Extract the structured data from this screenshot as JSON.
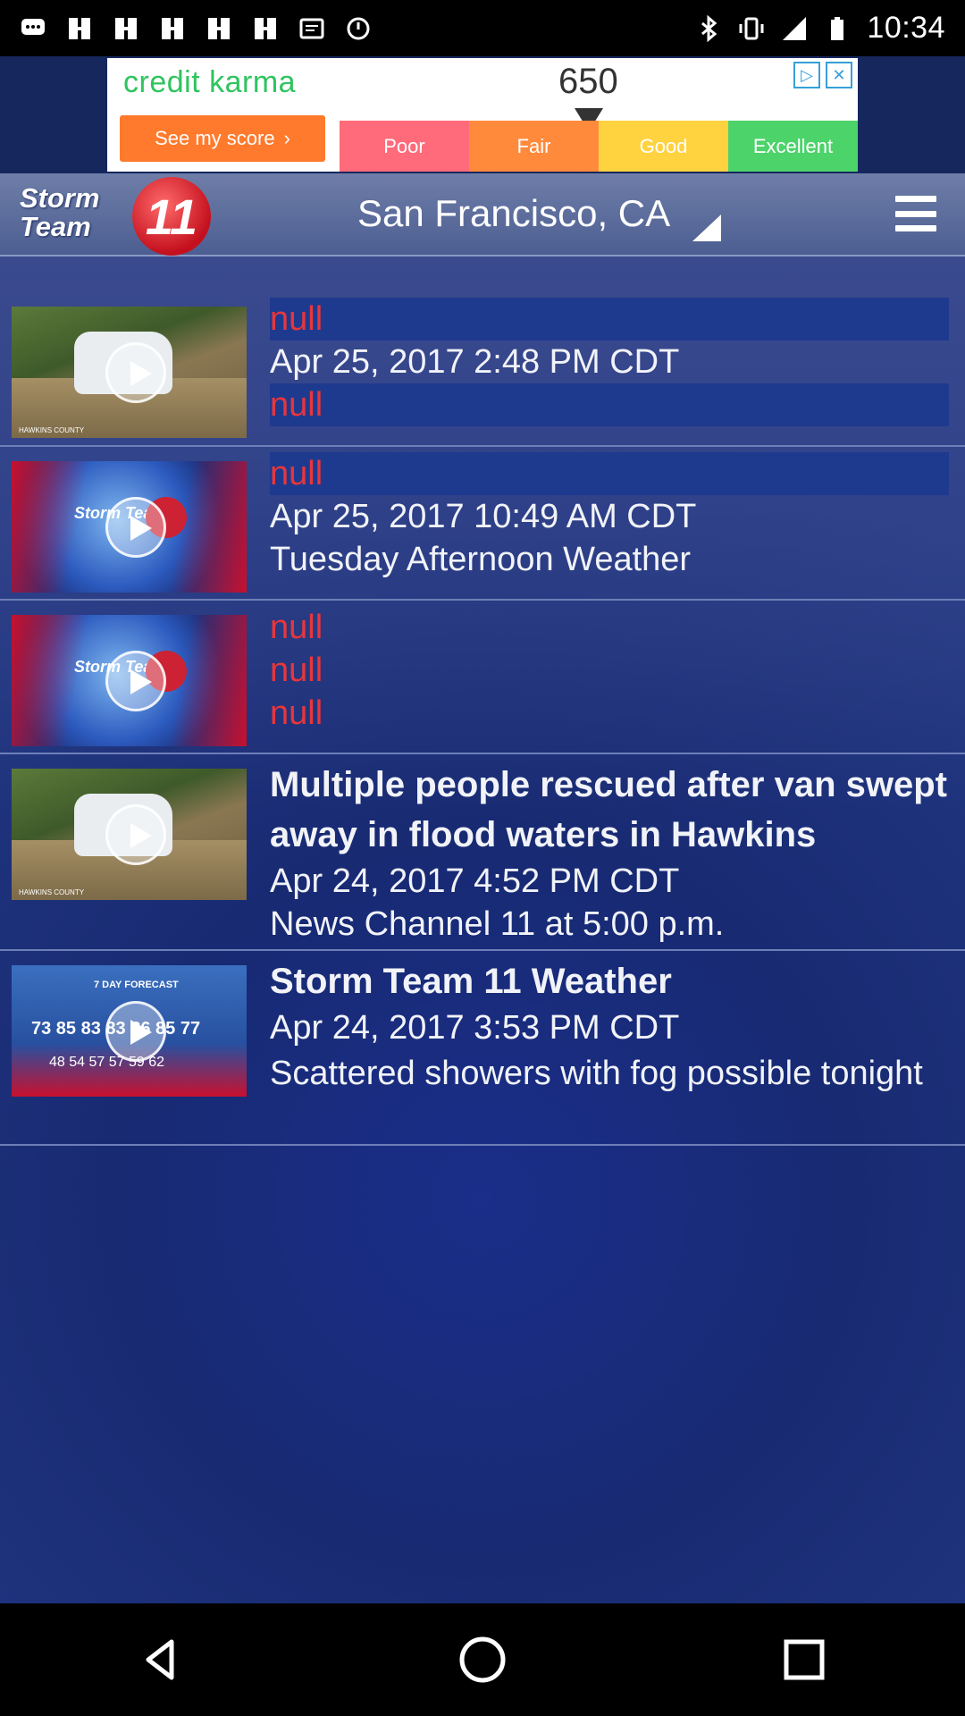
{
  "status_bar": {
    "time": "10:34",
    "icons_left": [
      "chat-icon",
      "grid-icon",
      "grid-icon",
      "grid-icon",
      "grid-icon",
      "grid-icon",
      "message-icon",
      "alarm-icon"
    ],
    "icons_right": [
      "bluetooth-icon",
      "vibrate-icon",
      "signal-icon",
      "battery-icon"
    ]
  },
  "ad": {
    "brand": "credit karma",
    "cta": "See my score",
    "score": "650",
    "segments": [
      {
        "label": "Poor",
        "color": "#ff6b7a"
      },
      {
        "label": "Fair",
        "color": "#ff8a3c"
      },
      {
        "label": "Good",
        "color": "#ffd23f"
      },
      {
        "label": "Excellent",
        "color": "#4cd36a"
      }
    ]
  },
  "header": {
    "logo_text_line1": "Storm",
    "logo_text_line2": "Team",
    "logo_badge": "11",
    "location": "San Francisco, CA"
  },
  "items": [
    {
      "thumb": "flood",
      "lines": [
        "null",
        "Apr 25, 2017 2:48 PM CDT",
        "null"
      ]
    },
    {
      "thumb": "storm",
      "lines": [
        "null",
        "Apr 25, 2017 10:49 AM CDT",
        "Tuesday Afternoon Weather"
      ]
    },
    {
      "thumb": "storm",
      "lines": [
        "null",
        "null",
        "null"
      ]
    },
    {
      "thumb": "flood",
      "lines": [
        "Multiple people rescued after van swept away in flood waters in Hawkins",
        "Apr 24, 2017 4:52 PM CDT",
        "News Channel 11 at 5:00 p.m."
      ]
    },
    {
      "thumb": "forecast",
      "lines": [
        "Storm Team 11 Weather",
        "Apr 24, 2017 3:53 PM CDT",
        "Scattered showers with fog possible tonight"
      ]
    }
  ],
  "thumbs": {
    "flood_caption": "HAWKINS COUNTY",
    "storm_text": "Storm Team",
    "forecast_title": "7 DAY FORECAST",
    "forecast_highs": "73 85 83 83 86 85 77",
    "forecast_lows": "48 54 57 57 59 62"
  },
  "nav": [
    "back-icon",
    "home-icon",
    "recents-icon"
  ]
}
